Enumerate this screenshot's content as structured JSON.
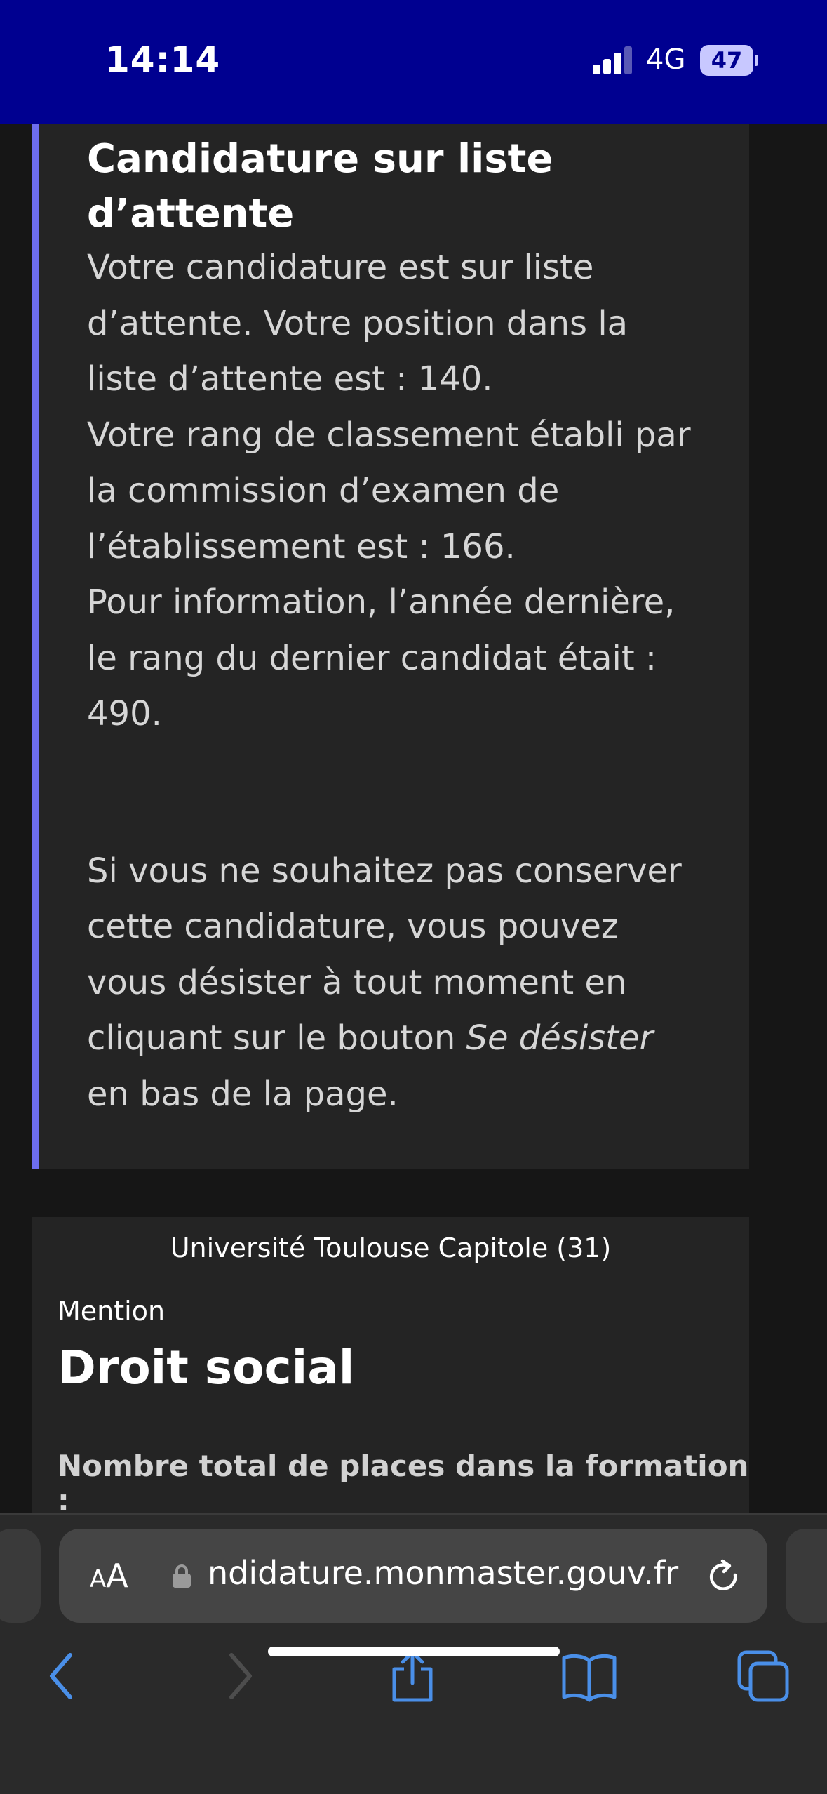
{
  "status_bar": {
    "time": "14:14",
    "network": "4G",
    "battery": "47"
  },
  "notice": {
    "title_line1": "Candidature sur liste",
    "title_line2": "d’attente",
    "lines": [
      "Votre candidature est sur liste",
      "d’attente. Votre position dans la",
      "liste d’attente est : 140.",
      "Votre rang de classement établi par",
      "la commission d’examen de",
      "l’établissement est : 166.",
      "Pour information, l’année dernière,",
      "le rang du dernier candidat était :",
      "490."
    ],
    "withdraw_lines": [
      "Si vous ne souhaitez pas conserver",
      "cette candidature, vous pouvez",
      "vous désister à tout moment en"
    ],
    "withdraw_line4_prefix": "cliquant sur le bouton ",
    "withdraw_line4_italic": "Se désister",
    "withdraw_line5": "en bas de la page."
  },
  "formation": {
    "university": "Université Toulouse Capitole (31)",
    "mention_label": "Mention",
    "title": "Droit social",
    "places_label": "Nombre total de places dans la formation :"
  },
  "browser": {
    "text_size_label_small": "A",
    "text_size_label_large": "A",
    "url": "ndidature.monmaster.gouv.fr"
  },
  "colors": {
    "status_bar": "#000090",
    "accent_border": "#6e6ef0",
    "ios_blue": "#4a8fe8"
  }
}
